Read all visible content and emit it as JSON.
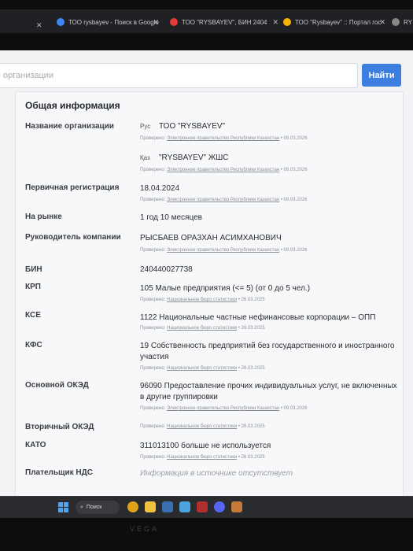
{
  "browser": {
    "tabs": [
      {
        "label": "ТОО rysbayev - Поиск в Google",
        "color": "#4285f4"
      },
      {
        "label": "ТОО \"RYSBAYEV\", БИН 2404",
        "color": "#e53935"
      },
      {
        "label": "ТОО \"Rysbayev\" :: Портал гос",
        "color": "#f5b400"
      },
      {
        "label": "RY",
        "color": "#888888"
      }
    ]
  },
  "search": {
    "placeholder": "организации",
    "button_label": "Найти"
  },
  "section_title": "Общая информация",
  "verified_prefix": "Проверено:",
  "fields": {
    "name_label": "Название организации",
    "name_rus_lang": "Рус",
    "name_rus": "ТОО \"RYSBAYEV\"",
    "name_rus_src": "Электронное правительство Республики Казахстан",
    "name_rus_date": "• 09.03.2026",
    "name_kaz_lang": "Қаз",
    "name_kaz": "\"RYSBAYEV\" ЖШС",
    "name_kaz_src": "Электронное правительство Республики Казахстан",
    "name_kaz_date": "• 09.03.2026",
    "reg_label": "Первичная регистрация",
    "reg_value": "18.04.2024",
    "reg_src": "Электронное правительство Республики Казахстан",
    "reg_date": "• 09.03.2026",
    "market_label": "На рынке",
    "market_value": "1 год 10 месяцев",
    "head_label": "Руководитель компании",
    "head_value": "РЫСБАЕВ ОРАЗХАН АСИМХАНОВИЧ",
    "head_src": "Электронное правительство Республики Казахстан",
    "head_date": "• 09.03.2026",
    "bin_label": "БИН",
    "bin_value": "240440027738",
    "krp_label": "КРП",
    "krp_value": "105 Малые предприятия (<= 5) (от 0 до 5 чел.)",
    "krp_src": "Национальное бюро статистики",
    "krp_date": "• 26.03.2025",
    "kse_label": "КСЕ",
    "kse_value": "1122 Национальные частные нефинансовые корпорации – ОПП",
    "kse_src": "Национальное бюро статистики",
    "kse_date": "• 26.03.2025",
    "kfs_label": "КФС",
    "kfs_value": "19 Собственность предприятий без государственного и иностранного участия",
    "kfs_src": "Национальное бюро статистики",
    "kfs_date": "• 26.03.2025",
    "oked_label": "Основной ОКЭД",
    "oked_value": "96090 Предоставление прочих индивидуальных услуг, не включенных в другие группировки",
    "oked_src": "Электронное правительство Республики Казахстан",
    "oked_date": "• 09.03.2026",
    "oked2_label": "Вторичный ОКЭД",
    "oked2_src": "Национальное бюро статистики",
    "oked2_date": "• 26.03.2025",
    "kato_label": "КАТО",
    "kato_value": "311013100 больше не используется",
    "kato_src": "Национальное бюро статистики",
    "kato_date": "• 26.03.2025",
    "nds_label": "Плательщик НДС",
    "nds_value": "Информация в источнике отсутствует"
  },
  "taskbar": {
    "search_label": "Поиск"
  },
  "bezel": {
    "brand": "VEGA"
  }
}
